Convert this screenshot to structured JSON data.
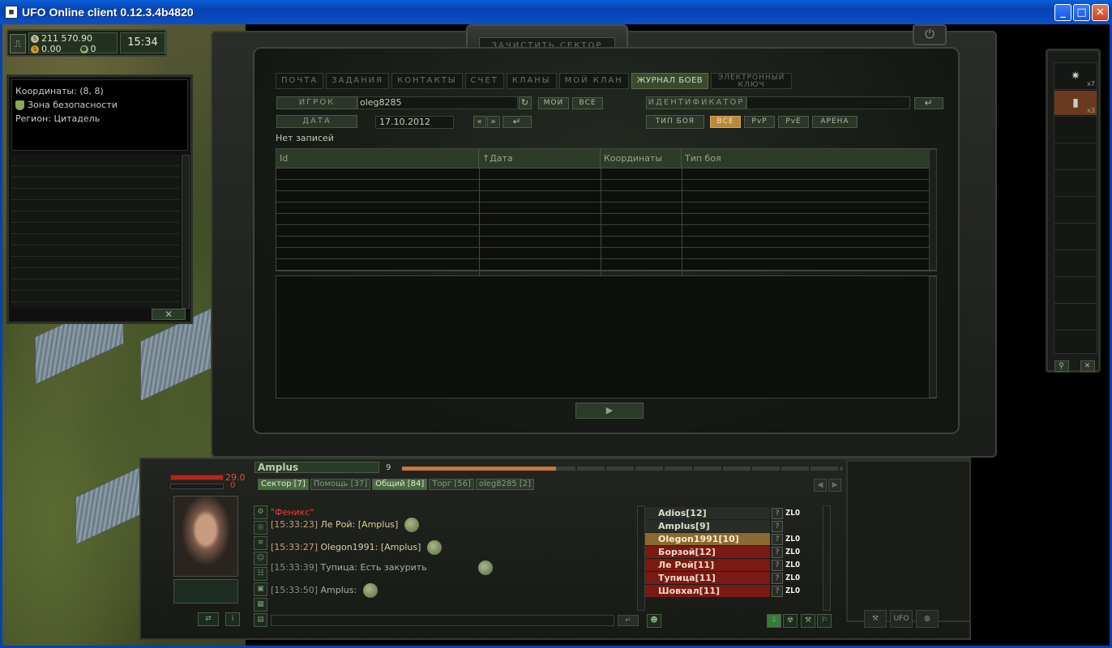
{
  "window": {
    "title": "UFO Online client 0.12.3.4b4820",
    "minimize": "_",
    "maximize": "□",
    "close": "✕"
  },
  "status": {
    "money_silver": "211 570.90",
    "money_gold": "0.00",
    "tokens": "0",
    "clock": "15:34"
  },
  "info": {
    "coords": "Координаты: (8, 8)",
    "zone": "Зона безопасности",
    "region": "Регион: Цитадель"
  },
  "main": {
    "header_button": "ЗАЧИСТИТЬ СЕКТОР",
    "tabs": [
      {
        "label": "ПОЧТА"
      },
      {
        "label": "ЗАДАНИЯ"
      },
      {
        "label": "КОНТАКТЫ"
      },
      {
        "label": "СЧЕТ"
      },
      {
        "label": "КЛАНЫ"
      },
      {
        "label": "МОЙ КЛАН"
      },
      {
        "label": "ЖУРНАЛ БОЕВ"
      },
      {
        "label": "ЭЛЕКТРОННЫЙ КЛЮЧ"
      }
    ],
    "player_label": "ИГРОК",
    "player_value": "oleg8285",
    "my_button": "МОИ",
    "all_button": "ВСЕ",
    "identifier_label": "ИДЕНТИФИКАТОР",
    "date_label": "ДАТА",
    "date_value": "17.10.2012",
    "battle_type_label": "ТИП БОЯ",
    "battle_types": [
      "ВСЕ",
      "PvP",
      "PvE",
      "АРЕНА"
    ],
    "no_records": "Нет записей",
    "columns": [
      "Id",
      "↑Дата",
      "Координаты",
      "Тип боя"
    ]
  },
  "inventory": {
    "items": [
      {
        "icon": "grenade-icon",
        "count": "x7"
      },
      {
        "icon": "medkit-icon",
        "count": "x3"
      }
    ]
  },
  "character": {
    "hp": "29.0",
    "psi": "0"
  },
  "chat": {
    "player_name": "Amplus",
    "level": "9",
    "xp_fraction": 0.35,
    "tabs": [
      {
        "label": "Сектор [7]",
        "active": true
      },
      {
        "label": "Помощь [37]",
        "active": false
      },
      {
        "label": "Общий [84]",
        "active": true
      },
      {
        "label": "Торг [56]",
        "active": false
      },
      {
        "label": "oleg8285 [2]",
        "active": false
      }
    ],
    "clan_header": "\"Феникс\"",
    "messages": [
      {
        "time": "[15:33:23]",
        "text": "Ле Рой: [Amplus]"
      },
      {
        "time": "[15:33:27]",
        "text": "Olegon1991: [Amplus]"
      },
      {
        "time": "[15:33:39]",
        "text": "Тупица: Есть закурить"
      },
      {
        "time": "[15:33:50]",
        "text": "Amplus:"
      }
    ],
    "players": [
      {
        "name": "Adios[12]",
        "tag": "ZLO",
        "style": "normal"
      },
      {
        "name": "Amplus[9]",
        "tag": "",
        "style": "normal"
      },
      {
        "name": "Olegon1991[10]",
        "tag": "ZLO",
        "style": "gold"
      },
      {
        "name": "Борзой[12]",
        "tag": "ZLO",
        "style": "red"
      },
      {
        "name": "Ле Рой[11]",
        "tag": "ZLO",
        "style": "red"
      },
      {
        "name": "Тупица[11]",
        "tag": "ZLO",
        "style": "red"
      },
      {
        "name": "Шовхал[11]",
        "tag": "ZLO",
        "style": "red"
      }
    ]
  },
  "dock": {
    "ufo_label": "UFO"
  }
}
